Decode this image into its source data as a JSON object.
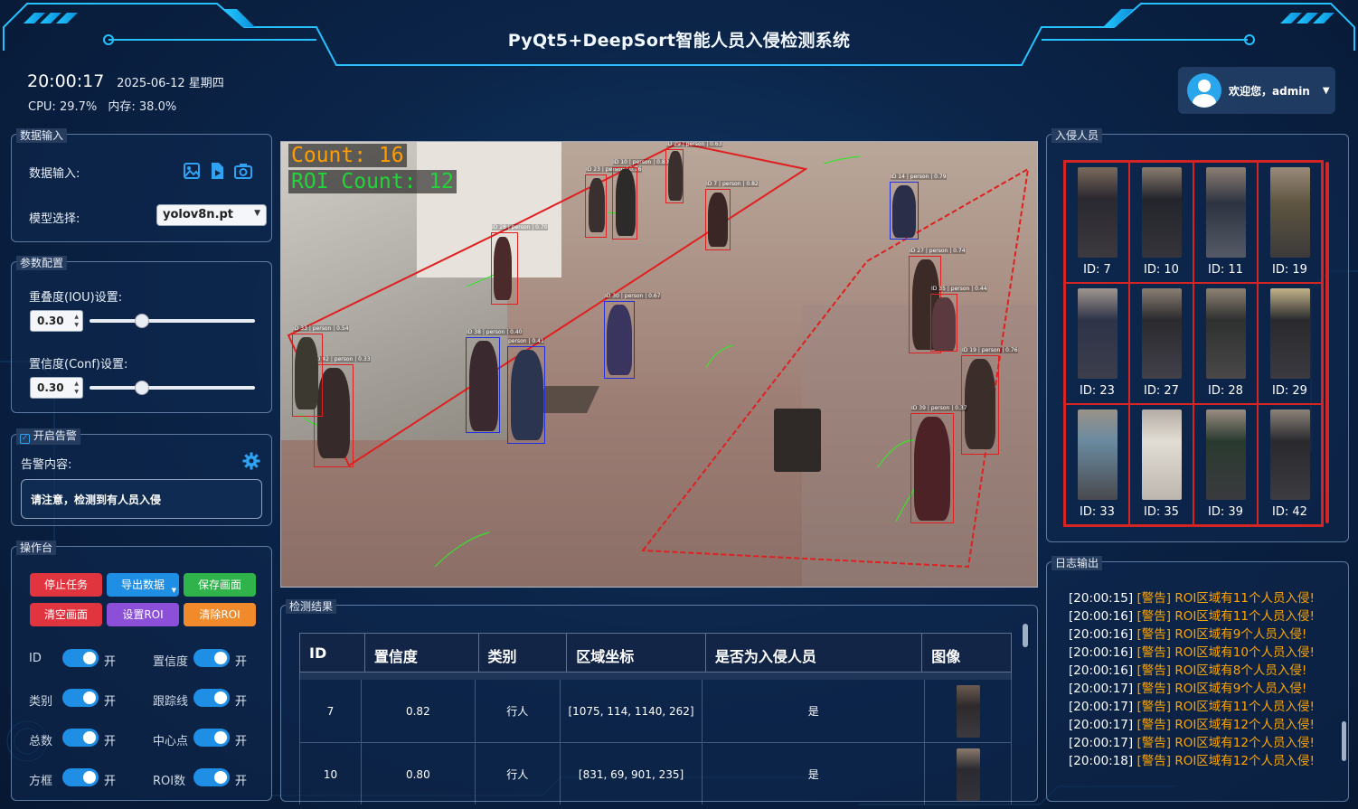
{
  "header": {
    "title": "PyQt5+DeepSort智能人员入侵检测系统",
    "time": "20:00:17",
    "date": "2025-06-12 星期四",
    "cpu": "CPU: 29.7%",
    "mem": "内存: 38.0%",
    "user": "欢迎您，admin"
  },
  "colors": {
    "accent": "#1f8fe5",
    "alarm": "#ffa500",
    "roi": "#e02020"
  },
  "data_input": {
    "panel_label": "数据输入",
    "input_label": "数据输入:",
    "model_label": "模型选择:",
    "model_value": "yolov8n.pt",
    "icons": [
      "image-icon",
      "video-icon",
      "camera-icon"
    ]
  },
  "params": {
    "panel_label": "参数配置",
    "iou_label": "重叠度(IOU)设置:",
    "iou_value": "0.30",
    "conf_label": "置信度(Conf)设置:",
    "conf_value": "0.30",
    "iou_slider_fraction": 0.3,
    "conf_slider_fraction": 0.3
  },
  "alarm": {
    "panel_label": "开启告警",
    "content_label": "告警内容:",
    "content": "请注意，检测到有人员入侵"
  },
  "ops": {
    "panel_label": "操作台",
    "buttons": [
      "停止任务",
      "导出数据",
      "保存画面",
      "清空画面",
      "设置ROI",
      "清除ROI"
    ],
    "toggles": [
      {
        "label": "ID",
        "state": "开"
      },
      {
        "label": "置信度",
        "state": "开"
      },
      {
        "label": "类别",
        "state": "开"
      },
      {
        "label": "跟踪线",
        "state": "开"
      },
      {
        "label": "总数",
        "state": "开"
      },
      {
        "label": "中心点",
        "state": "开"
      },
      {
        "label": "方框",
        "state": "开"
      },
      {
        "label": "ROI数",
        "state": "开"
      }
    ]
  },
  "video": {
    "count": "Count: 16",
    "roi_count": "ROI Count: 12",
    "boxes": [
      {
        "label": "ID 10 | person | 0.80",
        "coord": "(866, 152)"
      },
      {
        "label": "ID 29 | person | 0.63",
        "coord": "(864, 93)"
      },
      {
        "label": "ID 23 | person | 0.76",
        "coord": "(713, 186)"
      },
      {
        "label": "ID 7 | person | 0.82",
        "coord": "(1107, 188)"
      },
      {
        "label": "ID 28 | person | 0.70",
        "coord": "(565, 337)"
      },
      {
        "label": "ID 14 | person | 0.79",
        "coord": "(1533, 165)"
      },
      {
        "label": "ID 27 | person | 0.74",
        "coord": "(1632, 403)"
      },
      {
        "label": "ID 35 | person | 0.44",
        "coord": "(1653, 451)"
      },
      {
        "label": "ID 30 | person | 0.67",
        "coord": "(854, 477)"
      },
      {
        "label": "ID 38 | person | 0.40",
        "coord": "(512, 589)"
      },
      {
        "label": "ID 42 | person | 0.33",
        "coord": "(135, 663)"
      },
      {
        "label": "ID 33 | person | 0.54",
        "coord": "(88, 566)"
      },
      {
        "label": "ID 19 | person | 0.76",
        "coord": "(1741, 639)"
      },
      {
        "label": "ID 39 | person | 0.37",
        "coord": "(1649, 790)"
      },
      {
        "label": "person | 0.41",
        "coord": "(623, 800)"
      }
    ]
  },
  "results": {
    "panel_label": "检测结果",
    "columns": [
      "ID",
      "置信度",
      "类别",
      "区域坐标",
      "是否为入侵人员",
      "图像"
    ],
    "rows": [
      {
        "id": "7",
        "conf": "0.82",
        "cls": "行人",
        "box": "[1075, 114, 1140, 262]",
        "intrude": "是"
      },
      {
        "id": "10",
        "conf": "0.80",
        "cls": "行人",
        "box": "[831, 69, 901, 235]",
        "intrude": "是"
      }
    ]
  },
  "intruders": {
    "panel_label": "入侵人员",
    "ids": [
      "ID: 7",
      "ID: 10",
      "ID: 11",
      "ID: 19",
      "ID: 23",
      "ID: 27",
      "ID: 28",
      "ID: 29",
      "ID: 33",
      "ID: 35",
      "ID: 39",
      "ID: 42"
    ]
  },
  "log": {
    "panel_label": "日志输出",
    "entries": [
      {
        "ts": "[20:00:15]",
        "tag": "[警告]",
        "msg": "ROI区域有11个人员入侵!"
      },
      {
        "ts": "[20:00:16]",
        "tag": "[警告]",
        "msg": "ROI区域有11个人员入侵!"
      },
      {
        "ts": "[20:00:16]",
        "tag": "[警告]",
        "msg": "ROI区域有9个人员入侵!"
      },
      {
        "ts": "[20:00:16]",
        "tag": "[警告]",
        "msg": "ROI区域有10个人员入侵!"
      },
      {
        "ts": "[20:00:16]",
        "tag": "[警告]",
        "msg": "ROI区域有8个人员入侵!"
      },
      {
        "ts": "[20:00:17]",
        "tag": "[警告]",
        "msg": "ROI区域有9个人员入侵!"
      },
      {
        "ts": "[20:00:17]",
        "tag": "[警告]",
        "msg": "ROI区域有11个人员入侵!"
      },
      {
        "ts": "[20:00:17]",
        "tag": "[警告]",
        "msg": "ROI区域有12个人员入侵!"
      },
      {
        "ts": "[20:00:17]",
        "tag": "[警告]",
        "msg": "ROI区域有12个人员入侵!"
      },
      {
        "ts": "[20:00:18]",
        "tag": "[警告]",
        "msg": "ROI区域有12个人员入侵!"
      }
    ]
  }
}
